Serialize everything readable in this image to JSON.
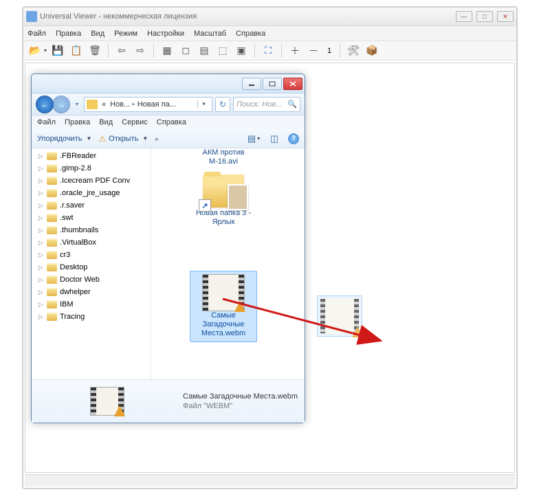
{
  "main": {
    "title": "Universal Viewer - некоммерческая лицензия",
    "menu": [
      "Файл",
      "Правка",
      "Вид",
      "Режим",
      "Настройки",
      "Масштаб",
      "Справка"
    ],
    "zoom_value": "1"
  },
  "explorer": {
    "crumb_prefix": "«",
    "crumb_1": "Нов...",
    "crumb_2": "Новая па...",
    "search_placeholder": "Поиск: Нов...",
    "menu": [
      "Файл",
      "Правка",
      "Вид",
      "Сервис",
      "Справка"
    ],
    "toolbar": {
      "organize": "Упорядочить",
      "open": "Открыть"
    },
    "tree": [
      ".FBReader",
      ".gimp-2.8",
      ".Icecream PDF Conv",
      ".oracle_jre_usage",
      ".r.saver",
      ".swt",
      ".thumbnails",
      ".VirtualBox",
      "cr3",
      "Desktop",
      "Doctor Web",
      "dwhelper",
      "IBM",
      "Tracing"
    ],
    "items": {
      "video1": {
        "line1": "АКМ против",
        "line2": "M-16.avi"
      },
      "shortcut": {
        "line1": "Новая папка 3 -",
        "line2": "Ярлык"
      },
      "selected": {
        "line1": "Самые",
        "line2": "Загадочные",
        "line3": "Места.webm"
      }
    },
    "details": {
      "title": "Самые Загадочные Места.webm",
      "sub": "Файл \"WEBM\""
    }
  }
}
